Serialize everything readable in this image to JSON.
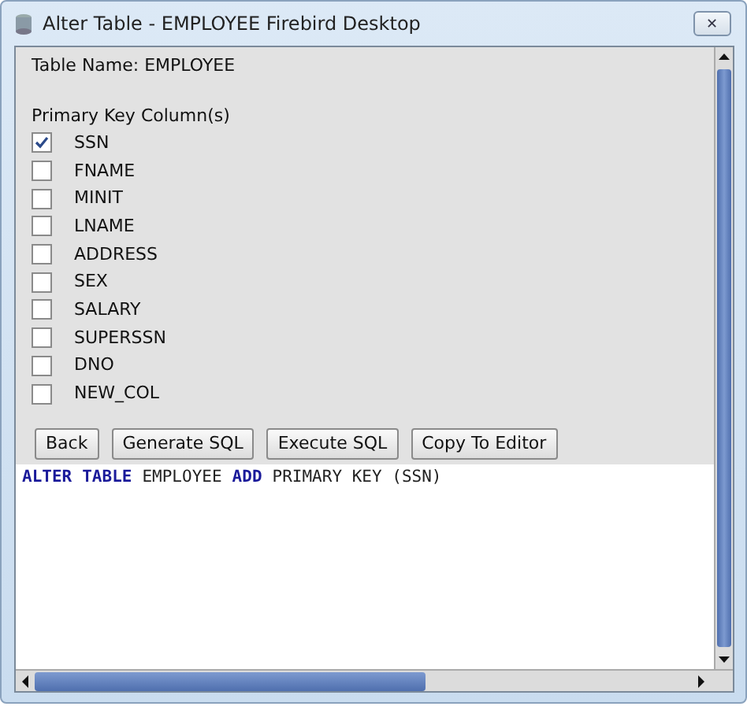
{
  "window": {
    "title": "Alter Table - EMPLOYEE Firebird Desktop",
    "close": "✕"
  },
  "table_name": "Table Name: EMPLOYEE",
  "primary_key_label": "Primary Key Column(s)",
  "columns": [
    {
      "label": "SSN",
      "checked": true
    },
    {
      "label": "FNAME",
      "checked": false
    },
    {
      "label": "MINIT",
      "checked": false
    },
    {
      "label": "LNAME",
      "checked": false
    },
    {
      "label": "ADDRESS",
      "checked": false
    },
    {
      "label": "SEX",
      "checked": false
    },
    {
      "label": "SALARY",
      "checked": false
    },
    {
      "label": "SUPERSSN",
      "checked": false
    },
    {
      "label": "DNO",
      "checked": false
    },
    {
      "label": "NEW_COL",
      "checked": false
    }
  ],
  "buttons": [
    "Back",
    "Generate SQL",
    "Execute SQL",
    "Copy To Editor"
  ],
  "sql": [
    {
      "text": "ALTER",
      "kind": "keyword"
    },
    {
      "text": "TABLE",
      "kind": "keyword"
    },
    {
      "text": "EMPLOYEE",
      "kind": "plain"
    },
    {
      "text": "ADD",
      "kind": "keyword"
    },
    {
      "text": "PRIMARY KEY (SSN)",
      "kind": "plain"
    }
  ]
}
